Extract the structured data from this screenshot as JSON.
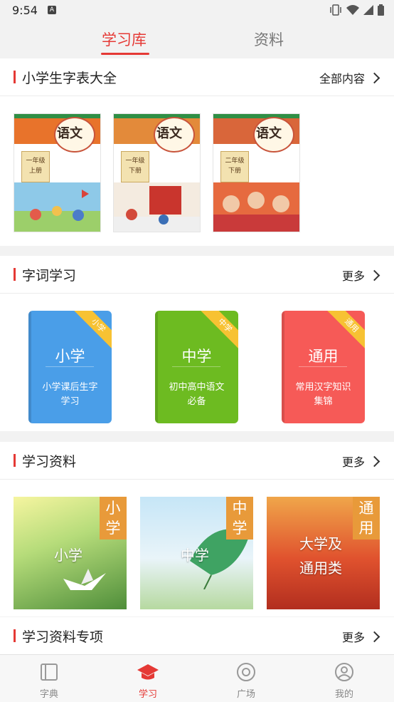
{
  "status": {
    "time": "9:54",
    "a_icon": "A"
  },
  "top_tabs": [
    {
      "label": "学习库",
      "active": true
    },
    {
      "label": "资料",
      "active": false
    }
  ],
  "section1": {
    "title": "小学生字表大全",
    "more": "全部内容",
    "covers": [
      {
        "title": "语文",
        "grade": "一年级",
        "term": "上册"
      },
      {
        "title": "语文",
        "grade": "一年级",
        "term": "下册"
      },
      {
        "title": "语文",
        "grade": "二年级",
        "term": "下册"
      }
    ]
  },
  "section2": {
    "title": "字词学习",
    "more": "更多",
    "cards": [
      {
        "title": "小学",
        "desc1": "小学课后生字",
        "desc2": "学习",
        "ribbon": "小学",
        "color": "#4a9ee8"
      },
      {
        "title": "中学",
        "desc1": "初中高中语文",
        "desc2": "必备",
        "ribbon": "中学",
        "color": "#6dbb21"
      },
      {
        "title": "通用",
        "desc1": "常用汉字知识",
        "desc2": "集锦",
        "ribbon": "通用",
        "color": "#f65a57"
      }
    ]
  },
  "section3": {
    "title": "学习资料",
    "more": "更多",
    "tiles": [
      {
        "tag": "小学",
        "label": "小学"
      },
      {
        "tag": "中学",
        "label": "中学"
      },
      {
        "tag": "通用",
        "label1": "大学及",
        "label2": "通用类"
      }
    ]
  },
  "section4": {
    "title": "学习资料专项",
    "more": "更多"
  },
  "bottom_tabs": [
    {
      "label": "字典",
      "icon": "book-icon",
      "active": false
    },
    {
      "label": "学习",
      "icon": "graduation-cap-icon",
      "active": true
    },
    {
      "label": "广场",
      "icon": "compass-icon",
      "active": false
    },
    {
      "label": "我的",
      "icon": "user-icon",
      "active": false
    }
  ],
  "colors": {
    "accent": "#e53935",
    "ribbon": "#f7c233",
    "tag": "#e89a3a"
  }
}
